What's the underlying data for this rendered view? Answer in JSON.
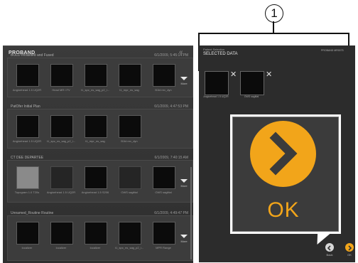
{
  "callout": {
    "number": "1"
  },
  "proband": {
    "title": "PROBAND",
    "groups": [
      {
        "name": "BOLD Intrasited and Fused",
        "time": "6/1/2009, 5:45:14 PM",
        "thumbs": [
          "Angioehead 1.5 UQ2R",
          "Head MR I FV",
          "t1_spc_ns_sag_p2_i...",
          "t1_mpr_ns_sag",
          "B1ld rev_dyn"
        ],
        "more": "More"
      },
      {
        "name": "PatOfer Initial Plan",
        "time": "6/1/2009, 4:47:53 PM",
        "thumbs": [
          "Angioehead 1.5 UQ2R",
          "t1_spc_ns_sag_p2_i...",
          "t1_mpr_ns_sag",
          "B1ld rev_dyn"
        ],
        "more": ""
      },
      {
        "name": "CT DEE DEPARTEE",
        "time": "6/1/2009, 7:40:15 AM",
        "thumbs": [
          "Topogram 1.0 T20s",
          "Angioehead 1.5 UQ2R",
          "Angioehead 1.5 S206",
          "OWS sagittal",
          "OWS sagittal"
        ],
        "more": "More"
      },
      {
        "name": "Unnamed_Routine Routine",
        "time": "6/1/2009, 4:49:47 PM",
        "thumbs": [
          "localizer",
          "localizer",
          "localizer",
          "t1_spc_ns_sag_p2_i...",
          "MPR Range"
        ],
        "more": "More"
      }
    ]
  },
  "selected": {
    "subtitle": "Patient Selection",
    "title": "SELECTED DATA",
    "proband_tag": "PROBAND MR0075",
    "items": [
      {
        "label": "Angioehead 1.5 UQ2R",
        "remove": "✕"
      },
      {
        "label": "OWS sagittal",
        "remove": "✕"
      }
    ]
  },
  "zoom": {
    "label": "OK"
  },
  "nav": {
    "back": "Back",
    "ok": "OK"
  },
  "colors": {
    "accent": "#f2a51a",
    "panel": "#2c2c2c"
  }
}
